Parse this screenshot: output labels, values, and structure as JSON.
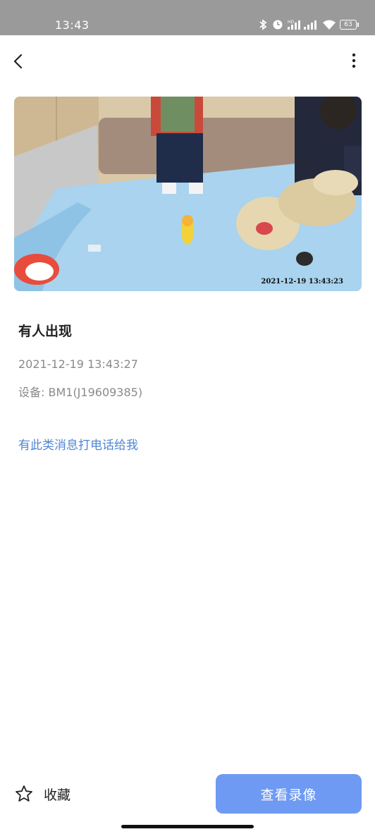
{
  "status_bar": {
    "time": "13:43",
    "battery": "63",
    "network": "HD"
  },
  "header": {
    "back_icon": "chevron-left-icon",
    "more_icon": "more-vertical-icon"
  },
  "snapshot": {
    "overlay_timestamp": "2021-12-19 13:43:23"
  },
  "event": {
    "title": "有人出现",
    "datetime": "2021-12-19 13:43:27",
    "device": "设备: BM1(J19609385)"
  },
  "call_link": "有此类消息打电话给我",
  "footer": {
    "favorite_icon": "star-icon",
    "favorite_label": "收藏",
    "view_button_label": "查看录像",
    "accent_color": "#6e9af3"
  }
}
